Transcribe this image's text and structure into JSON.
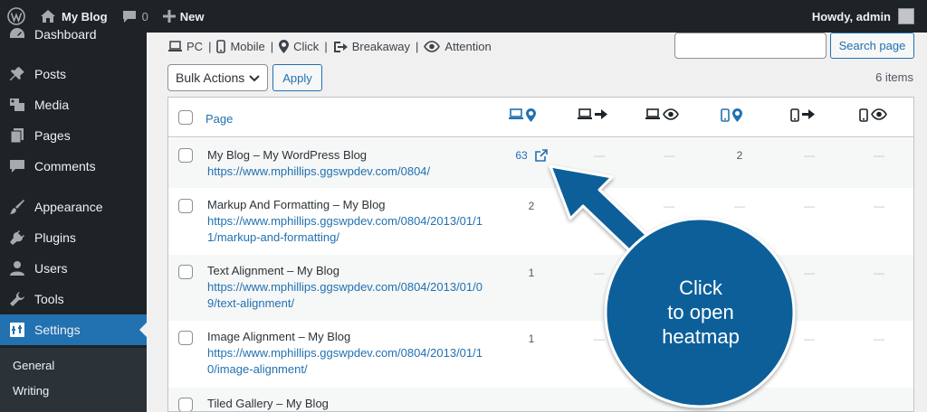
{
  "adminbar": {
    "site_name": "My Blog",
    "comment_count": "0",
    "new_label": "New",
    "howdy": "Howdy, admin"
  },
  "sidebar": {
    "items": [
      {
        "label": "Dashboard",
        "icon": "dashboard-icon"
      },
      {
        "label": "Posts",
        "icon": "pin-icon"
      },
      {
        "label": "Media",
        "icon": "media-icon"
      },
      {
        "label": "Pages",
        "icon": "pages-icon"
      },
      {
        "label": "Comments",
        "icon": "comment-icon"
      },
      {
        "label": "Appearance",
        "icon": "brush-icon"
      },
      {
        "label": "Plugins",
        "icon": "plug-icon"
      },
      {
        "label": "Users",
        "icon": "user-icon"
      },
      {
        "label": "Tools",
        "icon": "wrench-icon"
      },
      {
        "label": "Settings",
        "icon": "settings-icon",
        "active": true
      }
    ],
    "submenu": [
      "General",
      "Writing"
    ]
  },
  "filters": [
    "PC",
    "Mobile",
    "Click",
    "Breakaway",
    "Attention"
  ],
  "search": {
    "value": "",
    "button_label": "Search page"
  },
  "bulk": {
    "selected": "Bulk Actions",
    "apply_label": "Apply",
    "item_count": "6 items"
  },
  "table": {
    "page_header": "Page",
    "column_icons": [
      "pc-click-icon",
      "pc-breakaway-icon",
      "pc-attention-icon",
      "mobile-click-icon",
      "mobile-breakaway-icon",
      "mobile-attention-icon"
    ],
    "rows": [
      {
        "title": "My Blog – My WordPress Blog",
        "url": "https://www.mphillips.ggswpdev.com/0804/",
        "cells": [
          "63",
          "—",
          "—",
          "2",
          "—",
          "—"
        ]
      },
      {
        "title": "Markup And Formatting – My Blog",
        "url": "https://www.mphillips.ggswpdev.com/0804/2013/01/11/markup-and-formatting/",
        "cells": [
          "2",
          "—",
          "—",
          "—",
          "—",
          "—"
        ]
      },
      {
        "title": "Text Alignment – My Blog",
        "url": "https://www.mphillips.ggswpdev.com/0804/2013/01/09/text-alignment/",
        "cells": [
          "1",
          "—",
          "—",
          "—",
          "—",
          "—"
        ]
      },
      {
        "title": "Image Alignment – My Blog",
        "url": "https://www.mphillips.ggswpdev.com/0804/2013/01/10/image-alignment/",
        "cells": [
          "1",
          "—",
          "—",
          "—",
          "—",
          "—"
        ]
      },
      {
        "title": "Tiled Gallery – My Blog",
        "url": "",
        "cells": [
          "",
          "",
          "",
          "",
          "",
          ""
        ]
      }
    ]
  },
  "callout": {
    "lines": [
      "Click",
      "to open",
      "heatmap"
    ],
    "color": "#0e5f9a"
  },
  "colors": {
    "accent": "#2271b1",
    "adminbar": "#1d2327",
    "sidebar_active": "#2271b1"
  }
}
